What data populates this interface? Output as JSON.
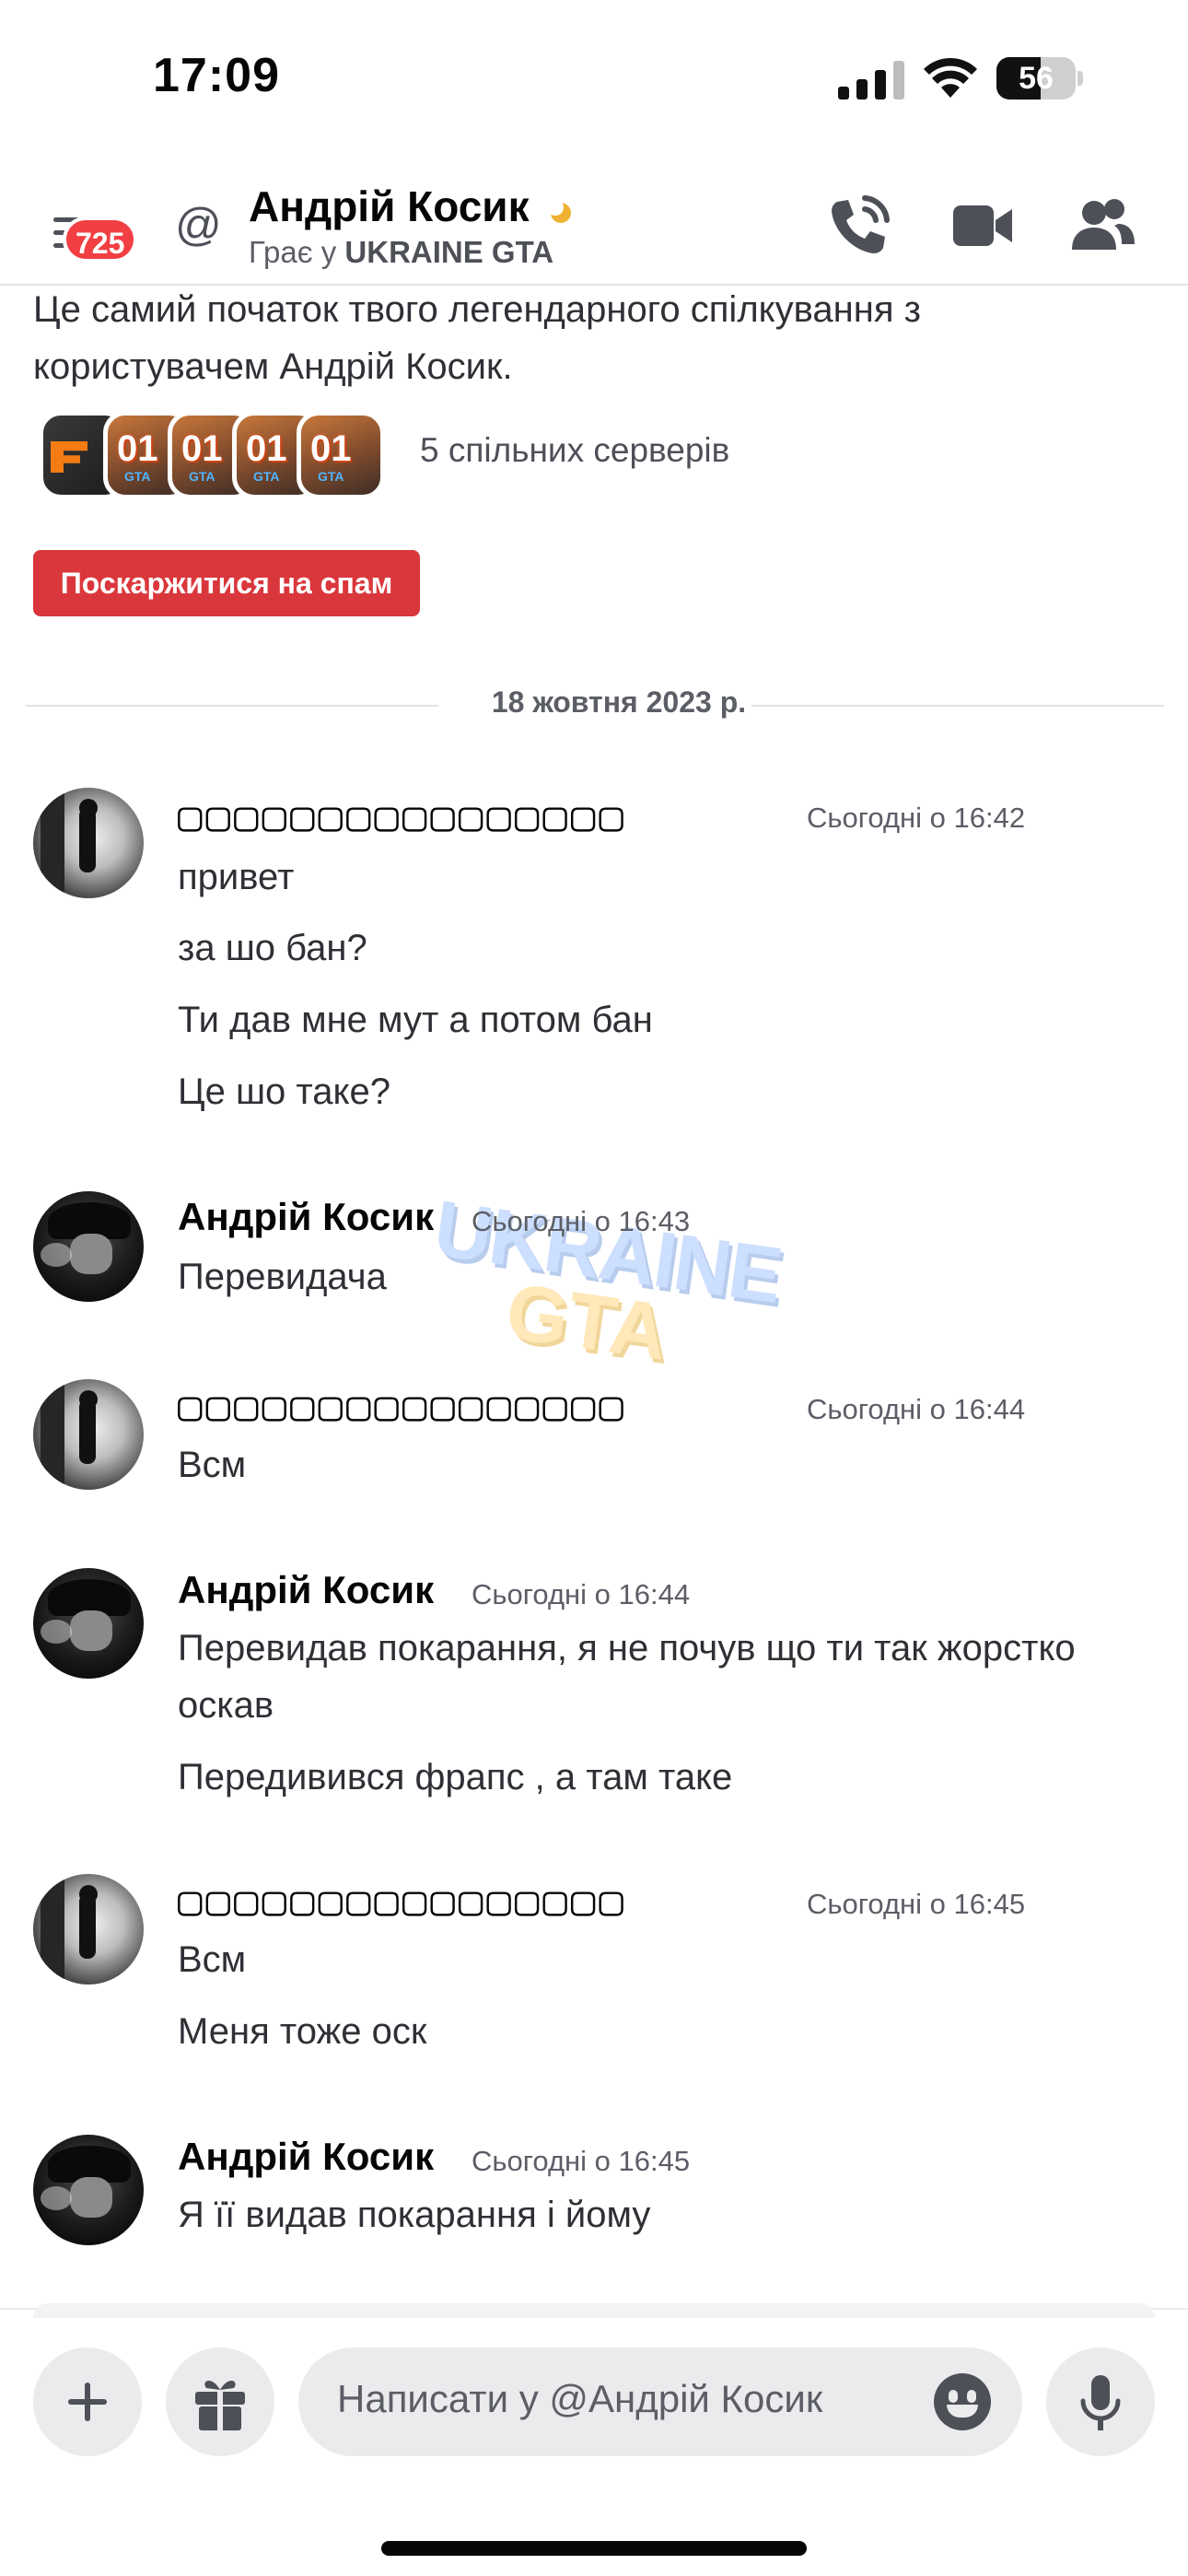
{
  "status_bar": {
    "time": "17:09",
    "battery": "56",
    "battery_level": 0.56
  },
  "header": {
    "unread_badge": "725",
    "name": "Андрій Косик",
    "status_prefix": "Грає у ",
    "status_game": "UKRAINE GTA",
    "icons": [
      "menu-icon",
      "at-icon",
      "phone-call-icon",
      "video-camera-icon",
      "members-icon"
    ]
  },
  "intro": {
    "text": "Це самий початок твого легендарного спілкування з користувачем Андрій Косик.",
    "mutual_servers_label": "5 спільних серверів",
    "server_icon_text": [
      "",
      "01",
      "01",
      "01",
      "01"
    ],
    "spam_button": "Поскаржитися на спам"
  },
  "date_divider": "18 жовтня 2023 р.",
  "messages": [
    {
      "author": "▢▢▢▢▢▢▢▢▢▢▢▢▢▢▢▢",
      "time": "Сьогодні о 16:42",
      "lines": [
        "привет",
        "за шо бан?",
        "Ти дав мне мут а потом бан",
        "Це шо таке?"
      ]
    },
    {
      "author": "Андрій Косик",
      "time": "Сьогодні о 16:43",
      "lines": [
        "Перевидача"
      ]
    },
    {
      "author": "▢▢▢▢▢▢▢▢▢▢▢▢▢▢▢▢",
      "time": "Сьогодні о 16:44",
      "lines": [
        "Всм"
      ]
    },
    {
      "author": "Андрій Косик",
      "time": "Сьогодні о 16:44",
      "lines": [
        "Перевидав покарання, я не почув що ти так жорстко оскав",
        "Передивився фрапс , а там таке"
      ]
    },
    {
      "author": "▢▢▢▢▢▢▢▢▢▢▢▢▢▢▢▢",
      "time": "Сьогодні о 16:45",
      "lines": [
        "Всм",
        "Меня тоже оск"
      ]
    },
    {
      "author": "Андрій Косик",
      "time": "Сьогодні о 16:45",
      "lines": [
        "Я її видав покарання і йому"
      ]
    }
  ],
  "watermark": {
    "line1": "UKRAINE",
    "line2": "GTA"
  },
  "composer": {
    "placeholder": "Написати у @Андрій Косик",
    "icons": [
      "plus-icon",
      "gift-icon",
      "emoji-icon",
      "microphone-icon"
    ]
  }
}
